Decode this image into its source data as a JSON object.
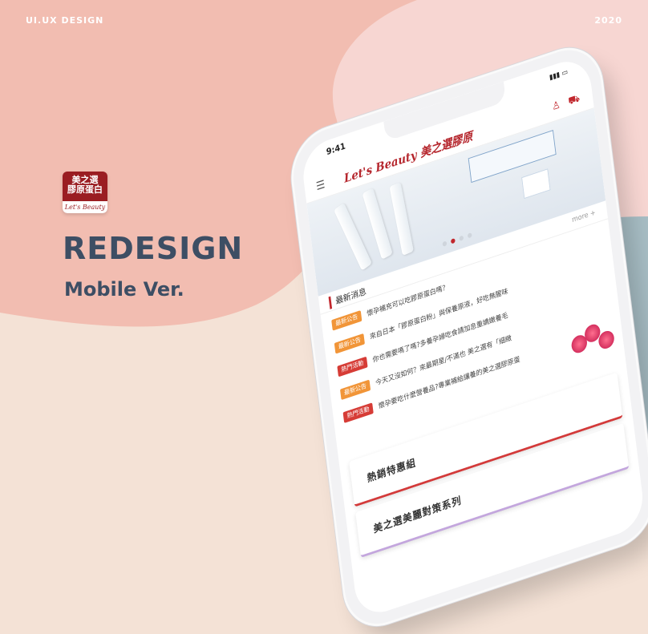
{
  "header": {
    "left_label": "UI.UX DESIGN",
    "right_label": "2020"
  },
  "logo": {
    "line1": "美之選",
    "line2": "膠原蛋白",
    "strip": "Let's Beauty"
  },
  "headline": "REDESIGN",
  "subheadline": "Mobile Ver.",
  "colors": {
    "peach": "#f2bdb1",
    "blush": "#f7d6d2",
    "cream": "#f4e2d6",
    "slate": "#a7bdc4",
    "title": "#3d4e64",
    "brand_red": "#b5252c"
  },
  "phone": {
    "time": "9:41",
    "menu_icon": "hamburger-icon",
    "brand": "Let's Beauty 美之選膠原",
    "user_icon": "user-icon",
    "cart_icon": "cart-icon",
    "news_title": "最新消息",
    "more": "more +",
    "news": [
      {
        "tag": "最新公告",
        "tag_color": "orange",
        "text": "懷孕補充可以吃膠原蛋白嗎？"
      },
      {
        "tag": "最新公告",
        "tag_color": "orange",
        "text": "來自日本「膠原蛋白粉」與保養原液，好吃無腥味"
      },
      {
        "tag": "熱門活動",
        "tag_color": "red",
        "text": "你也需要嗎了嗎?多養孕婦吃食請加息重嬌嫩養毛"
      },
      {
        "tag": "最新公告",
        "tag_color": "orange",
        "text": "今天又沒如何？來最期星/不滿也 美之選有「細緻"
      },
      {
        "tag": "熱門活動",
        "tag_color": "red",
        "text": "懷孕要吃什麼營養品?專業補給讓養的美之選膠原蛋"
      }
    ],
    "sections": [
      "熱銷特惠組",
      "美之選美麗對策系列"
    ]
  }
}
